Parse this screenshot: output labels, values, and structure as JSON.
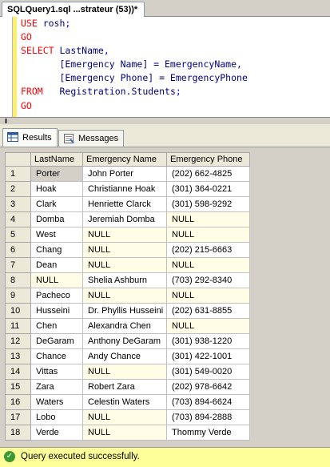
{
  "document_tab": "SQLQuery1.sql ...strateur (53))*",
  "code_lines": [
    [
      {
        "t": "USE ",
        "c": "kw"
      },
      {
        "t": "rosh",
        "c": "id"
      },
      {
        "t": ";",
        "c": ""
      }
    ],
    [
      {
        "t": "GO",
        "c": "kw"
      }
    ],
    [
      {
        "t": "SELECT ",
        "c": "kw"
      },
      {
        "t": "LastName",
        "c": "id"
      },
      {
        "t": ",",
        "c": ""
      }
    ],
    [
      {
        "t": "       [Emergency Name] = EmergencyName,",
        "c": "id"
      }
    ],
    [
      {
        "t": "       [Emergency Phone] = EmergencyPhone",
        "c": "id"
      }
    ],
    [
      {
        "t": "FROM   ",
        "c": "kw"
      },
      {
        "t": "Registration.Students",
        "c": "id"
      },
      {
        "t": ";",
        "c": ""
      }
    ],
    [
      {
        "t": "GO",
        "c": "kw"
      }
    ]
  ],
  "result_tabs": {
    "results": "Results",
    "messages": "Messages"
  },
  "grid": {
    "columns": [
      "LastName",
      "Emergency Name",
      "Emergency Phone"
    ],
    "rows": [
      [
        "1",
        "Porter",
        "John Porter",
        "(202) 662-4825"
      ],
      [
        "2",
        "Hoak",
        "Christianne Hoak",
        "(301) 364-0221"
      ],
      [
        "3",
        "Clark",
        "Henriette Clarck",
        "(301) 598-9292"
      ],
      [
        "4",
        "Domba",
        "Jeremiah Domba",
        "NULL"
      ],
      [
        "5",
        "West",
        "NULL",
        "NULL"
      ],
      [
        "6",
        "Chang",
        "NULL",
        "(202) 215-6663"
      ],
      [
        "7",
        "Dean",
        "NULL",
        "NULL"
      ],
      [
        "8",
        "NULL",
        "Shelia Ashburn",
        "(703) 292-8340"
      ],
      [
        "9",
        "Pacheco",
        "NULL",
        "NULL"
      ],
      [
        "10",
        "Husseini",
        "Dr. Phyllis Husseini",
        "(202) 631-8855"
      ],
      [
        "11",
        "Chen",
        "Alexandra Chen",
        "NULL"
      ],
      [
        "12",
        "DeGaram",
        "Anthony DeGaram",
        "(301) 938-1220"
      ],
      [
        "13",
        "Chance",
        "Andy Chance",
        "(301) 422-1001"
      ],
      [
        "14",
        "Vittas",
        "NULL",
        "(301) 549-0020"
      ],
      [
        "15",
        "Zara",
        "Robert Zara",
        "(202) 978-6642"
      ],
      [
        "16",
        "Waters",
        "Celestin Waters",
        "(703) 894-6624"
      ],
      [
        "17",
        "Lobo",
        "NULL",
        "(703) 894-2888"
      ],
      [
        "18",
        "Verde",
        "NULL",
        "Thommy Verde"
      ]
    ]
  },
  "status": "Query executed successfully.",
  "colors": {
    "keyword": "#ff0000",
    "identifier": "#000080",
    "null_cell": "#fffde6",
    "status_bg": "#ffff99"
  }
}
